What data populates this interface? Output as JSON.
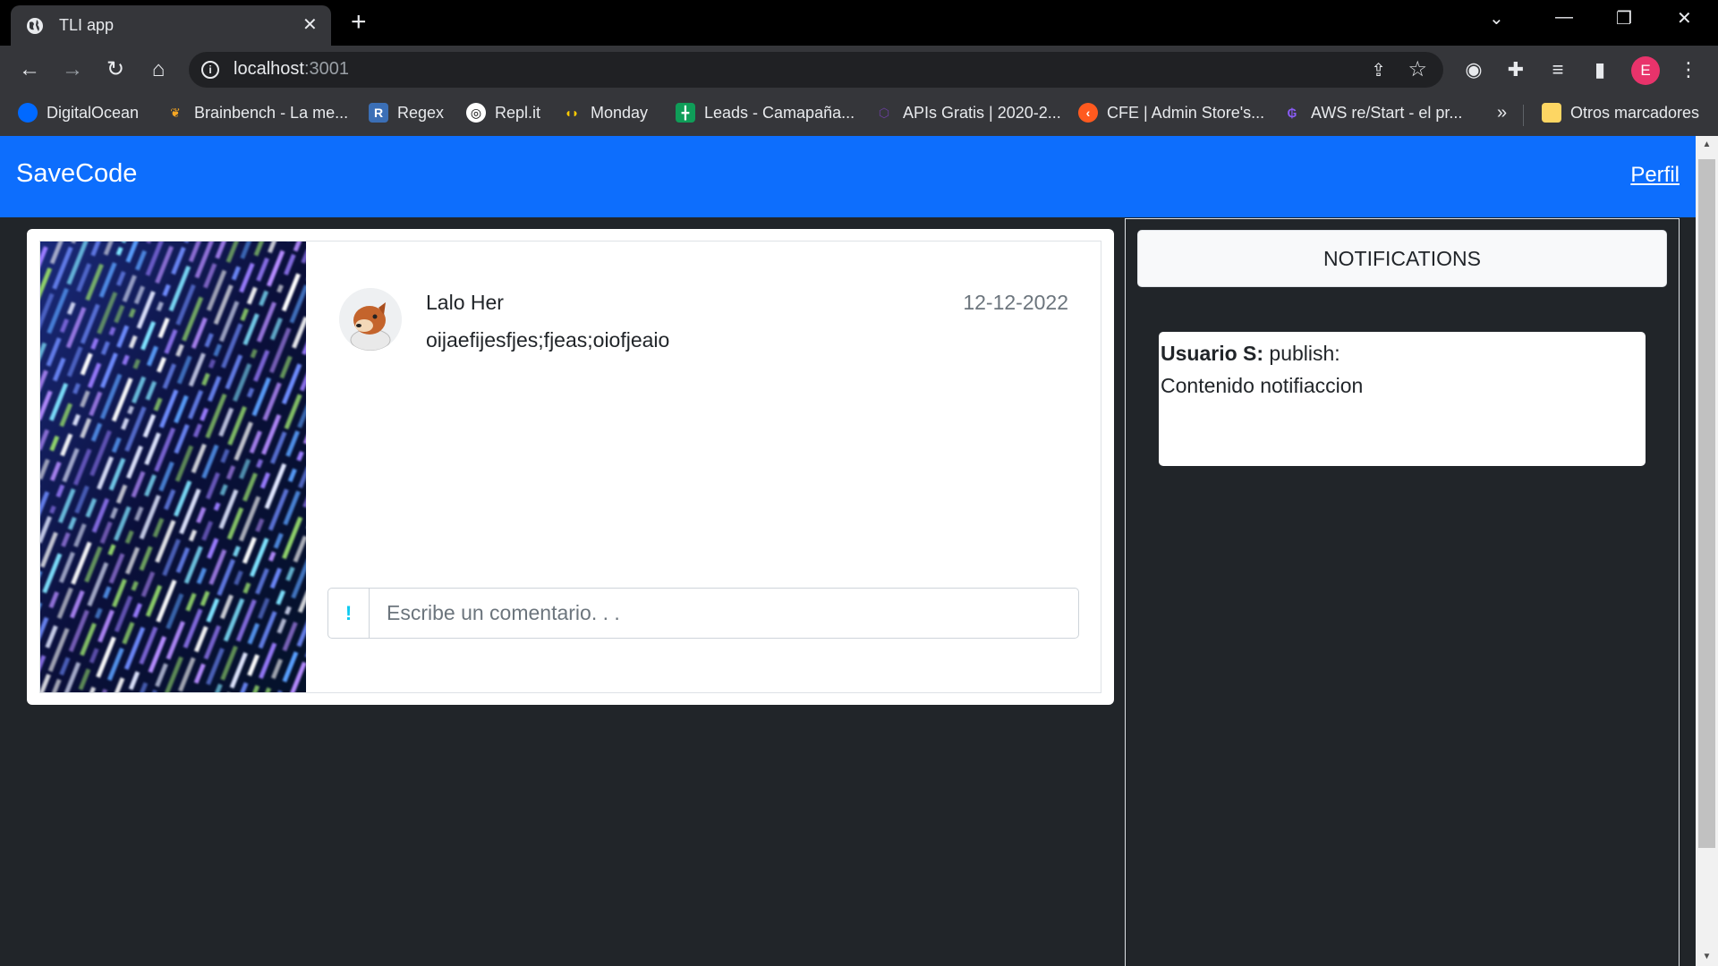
{
  "browser": {
    "tab_title": "TLI app",
    "url_host": "localhost",
    "url_port": ":3001",
    "profile_initial": "E",
    "bookmarks": [
      {
        "label": "DigitalOcean",
        "color": "#0069ff"
      },
      {
        "label": "Brainbench - La me...",
        "color": "#f5a623"
      },
      {
        "label": "Regex",
        "color": "#3b6fb6"
      },
      {
        "label": "Repl.it",
        "color": "#ffffff"
      },
      {
        "label": "Monday",
        "color": "#ff3d57"
      },
      {
        "label": "Leads - Camapaña...",
        "color": "#0f9d58"
      },
      {
        "label": "APIs Gratis | 2020-2...",
        "color": "#6b3fa0"
      },
      {
        "label": "CFE | Admin Store's...",
        "color": "#ff5a1f"
      },
      {
        "label": "AWS re/Start - el pr...",
        "color": "#5a2ca0"
      }
    ],
    "bookmarks_more": "»",
    "other_bookmarks": "Otros marcadores"
  },
  "app": {
    "brand": "SaveCode",
    "profile_link": "Perfil",
    "accent": "#0d6efd"
  },
  "post": {
    "author": "Lalo Her",
    "date": "12-12-2022",
    "text": "oijaefijesfjes;fjeas;oiofjeaio",
    "comment_addon": "!",
    "comment_placeholder": "Escribe un comentario. . ."
  },
  "notifications": {
    "header": "NOTIFICATIONS",
    "items": [
      {
        "user": "Usuario S:",
        "action": "publish:",
        "content": "Contenido notifiaccion"
      }
    ]
  }
}
